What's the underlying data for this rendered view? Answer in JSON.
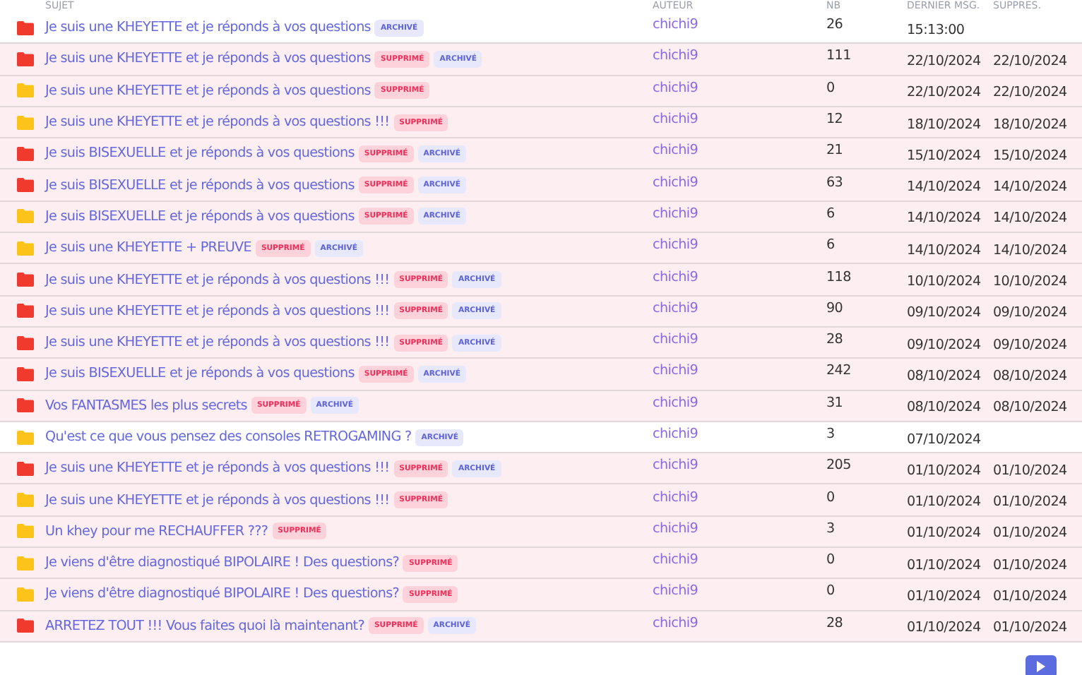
{
  "table": {
    "columns": [
      "SUJET",
      "AUTEUR",
      "NB",
      "DERNIER MSG.",
      "SUPPRES."
    ],
    "rows": [
      {
        "color": "#f03a2e",
        "title": "Je suis une KHEYETTE et je réponds à vos questions",
        "badges": [
          {
            "kind": "archived",
            "label": "ARCHIVÉ"
          }
        ],
        "author": "chichi9",
        "count": "26",
        "last_message": "15:13:00"
      },
      {
        "color": "#f03a2e",
        "title": "Je suis une KHEYETTE et je réponds à vos questions",
        "badges": [
          {
            "kind": "deleted",
            "label": "SUPPRIMÉ"
          },
          {
            "kind": "archived",
            "label": "ARCHIVÉ"
          }
        ],
        "author": "chichi9",
        "count": "111",
        "last_message": "22/10/2024",
        "deleted_on": "22/10/2024"
      },
      {
        "color": "#fcc41b",
        "title": "Je suis une KHEYETTE et je réponds à vos questions",
        "badges": [
          {
            "kind": "deleted",
            "label": "SUPPRIMÉ"
          }
        ],
        "author": "chichi9",
        "count": "0",
        "last_message": "22/10/2024",
        "deleted_on": "22/10/2024"
      },
      {
        "color": "#fcc41b",
        "title": "Je suis une KHEYETTE et je réponds à vos questions !!!",
        "badges": [
          {
            "kind": "deleted",
            "label": "SUPPRIMÉ"
          }
        ],
        "author": "chichi9",
        "count": "12",
        "last_message": "18/10/2024",
        "deleted_on": "18/10/2024"
      },
      {
        "color": "#f03a2e",
        "title": "Je suis BISEXUELLE et je réponds à vos questions",
        "badges": [
          {
            "kind": "deleted",
            "label": "SUPPRIMÉ"
          },
          {
            "kind": "archived",
            "label": "ARCHIVÉ"
          }
        ],
        "author": "chichi9",
        "count": "21",
        "last_message": "15/10/2024",
        "deleted_on": "15/10/2024"
      },
      {
        "color": "#f03a2e",
        "title": "Je suis BISEXUELLE et je réponds à vos questions",
        "badges": [
          {
            "kind": "deleted",
            "label": "SUPPRIMÉ"
          },
          {
            "kind": "archived",
            "label": "ARCHIVÉ"
          }
        ],
        "author": "chichi9",
        "count": "63",
        "last_message": "14/10/2024",
        "deleted_on": "14/10/2024"
      },
      {
        "color": "#fcc41b",
        "title": "Je suis BISEXUELLE et je réponds à vos questions",
        "badges": [
          {
            "kind": "deleted",
            "label": "SUPPRIMÉ"
          },
          {
            "kind": "archived",
            "label": "ARCHIVÉ"
          }
        ],
        "author": "chichi9",
        "count": "6",
        "last_message": "14/10/2024",
        "deleted_on": "14/10/2024"
      },
      {
        "color": "#fcc41b",
        "title": "Je suis une KHEYETTE + PREUVE",
        "badges": [
          {
            "kind": "deleted",
            "label": "SUPPRIMÉ"
          },
          {
            "kind": "archived",
            "label": "ARCHIVÉ"
          }
        ],
        "author": "chichi9",
        "count": "6",
        "last_message": "14/10/2024",
        "deleted_on": "14/10/2024"
      },
      {
        "color": "#f03a2e",
        "title": "Je suis une KHEYETTE et je réponds à vos questions !!!",
        "badges": [
          {
            "kind": "deleted",
            "label": "SUPPRIMÉ"
          },
          {
            "kind": "archived",
            "label": "ARCHIVÉ"
          }
        ],
        "author": "chichi9",
        "count": "118",
        "last_message": "10/10/2024",
        "deleted_on": "10/10/2024"
      },
      {
        "color": "#f03a2e",
        "title": "Je suis une KHEYETTE et je réponds à vos questions !!!",
        "badges": [
          {
            "kind": "deleted",
            "label": "SUPPRIMÉ"
          },
          {
            "kind": "archived",
            "label": "ARCHIVÉ"
          }
        ],
        "author": "chichi9",
        "count": "90",
        "last_message": "09/10/2024",
        "deleted_on": "09/10/2024"
      },
      {
        "color": "#f03a2e",
        "title": "Je suis une KHEYETTE et je réponds à vos questions !!!",
        "badges": [
          {
            "kind": "deleted",
            "label": "SUPPRIMÉ"
          },
          {
            "kind": "archived",
            "label": "ARCHIVÉ"
          }
        ],
        "author": "chichi9",
        "count": "28",
        "last_message": "09/10/2024",
        "deleted_on": "09/10/2024"
      },
      {
        "color": "#f03a2e",
        "title": "Je suis BISEXUELLE et je réponds à vos questions",
        "badges": [
          {
            "kind": "deleted",
            "label": "SUPPRIMÉ"
          },
          {
            "kind": "archived",
            "label": "ARCHIVÉ"
          }
        ],
        "author": "chichi9",
        "count": "242",
        "last_message": "08/10/2024",
        "deleted_on": "08/10/2024"
      },
      {
        "color": "#f03a2e",
        "title": "Vos FANTASMES les plus secrets",
        "badges": [
          {
            "kind": "deleted",
            "label": "SUPPRIMÉ"
          },
          {
            "kind": "archived",
            "label": "ARCHIVÉ"
          }
        ],
        "author": "chichi9",
        "count": "31",
        "last_message": "08/10/2024",
        "deleted_on": "08/10/2024"
      },
      {
        "color": "#fcc41b",
        "title": "Qu'est ce que vous pensez des consoles RETROGAMING ?",
        "badges": [
          {
            "kind": "archived",
            "label": "ARCHIVÉ"
          }
        ],
        "author": "chichi9",
        "count": "3",
        "last_message": "07/10/2024"
      },
      {
        "color": "#f03a2e",
        "title": "Je suis une KHEYETTE et je réponds à vos questions !!!",
        "badges": [
          {
            "kind": "deleted",
            "label": "SUPPRIMÉ"
          },
          {
            "kind": "archived",
            "label": "ARCHIVÉ"
          }
        ],
        "author": "chichi9",
        "count": "205",
        "last_message": "01/10/2024",
        "deleted_on": "01/10/2024"
      },
      {
        "color": "#fcc41b",
        "title": "Je suis une KHEYETTE et je réponds à vos questions !!!",
        "badges": [
          {
            "kind": "deleted",
            "label": "SUPPRIMÉ"
          }
        ],
        "author": "chichi9",
        "count": "0",
        "last_message": "01/10/2024",
        "deleted_on": "01/10/2024"
      },
      {
        "color": "#fcc41b",
        "title": "Un khey pour me RECHAUFFER ???",
        "badges": [
          {
            "kind": "deleted",
            "label": "SUPPRIMÉ"
          }
        ],
        "author": "chichi9",
        "count": "3",
        "last_message": "01/10/2024",
        "deleted_on": "01/10/2024"
      },
      {
        "color": "#fcc41b",
        "title": "Je viens d'être diagnostiqué BIPOLAIRE ! Des questions?",
        "badges": [
          {
            "kind": "deleted",
            "label": "SUPPRIMÉ"
          }
        ],
        "author": "chichi9",
        "count": "0",
        "last_message": "01/10/2024",
        "deleted_on": "01/10/2024"
      },
      {
        "color": "#fcc41b",
        "title": "Je viens d'être diagnostiqué BIPOLAIRE ! Des questions?",
        "badges": [
          {
            "kind": "deleted",
            "label": "SUPPRIMÉ"
          }
        ],
        "author": "chichi9",
        "count": "0",
        "last_message": "01/10/2024",
        "deleted_on": "01/10/2024"
      },
      {
        "color": "#f03a2e",
        "title": "ARRETEZ TOUT !!! Vous faites quoi là maintenant?",
        "badges": [
          {
            "kind": "deleted",
            "label": "SUPPRIMÉ"
          },
          {
            "kind": "archived",
            "label": "ARCHIVÉ"
          }
        ],
        "author": "chichi9",
        "count": "28",
        "last_message": "01/10/2024",
        "deleted_on": "01/10/2024"
      }
    ]
  }
}
